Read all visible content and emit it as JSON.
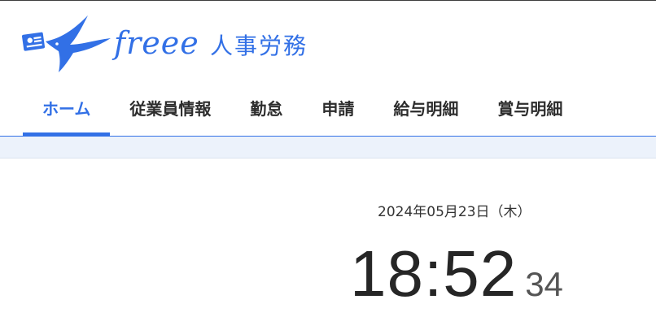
{
  "brand": {
    "logo_text": "freee",
    "product_name": "人事労務",
    "accent_color": "#3270e6"
  },
  "nav": {
    "items": [
      {
        "label": "ホーム",
        "active": true
      },
      {
        "label": "従業員情報",
        "active": false
      },
      {
        "label": "勤怠",
        "active": false
      },
      {
        "label": "申請",
        "active": false
      },
      {
        "label": "給与明細",
        "active": false
      },
      {
        "label": "賞与明細",
        "active": false
      }
    ]
  },
  "clock": {
    "date": "2024年05月23日（木）",
    "hours_minutes": "18:52",
    "seconds": "34"
  }
}
